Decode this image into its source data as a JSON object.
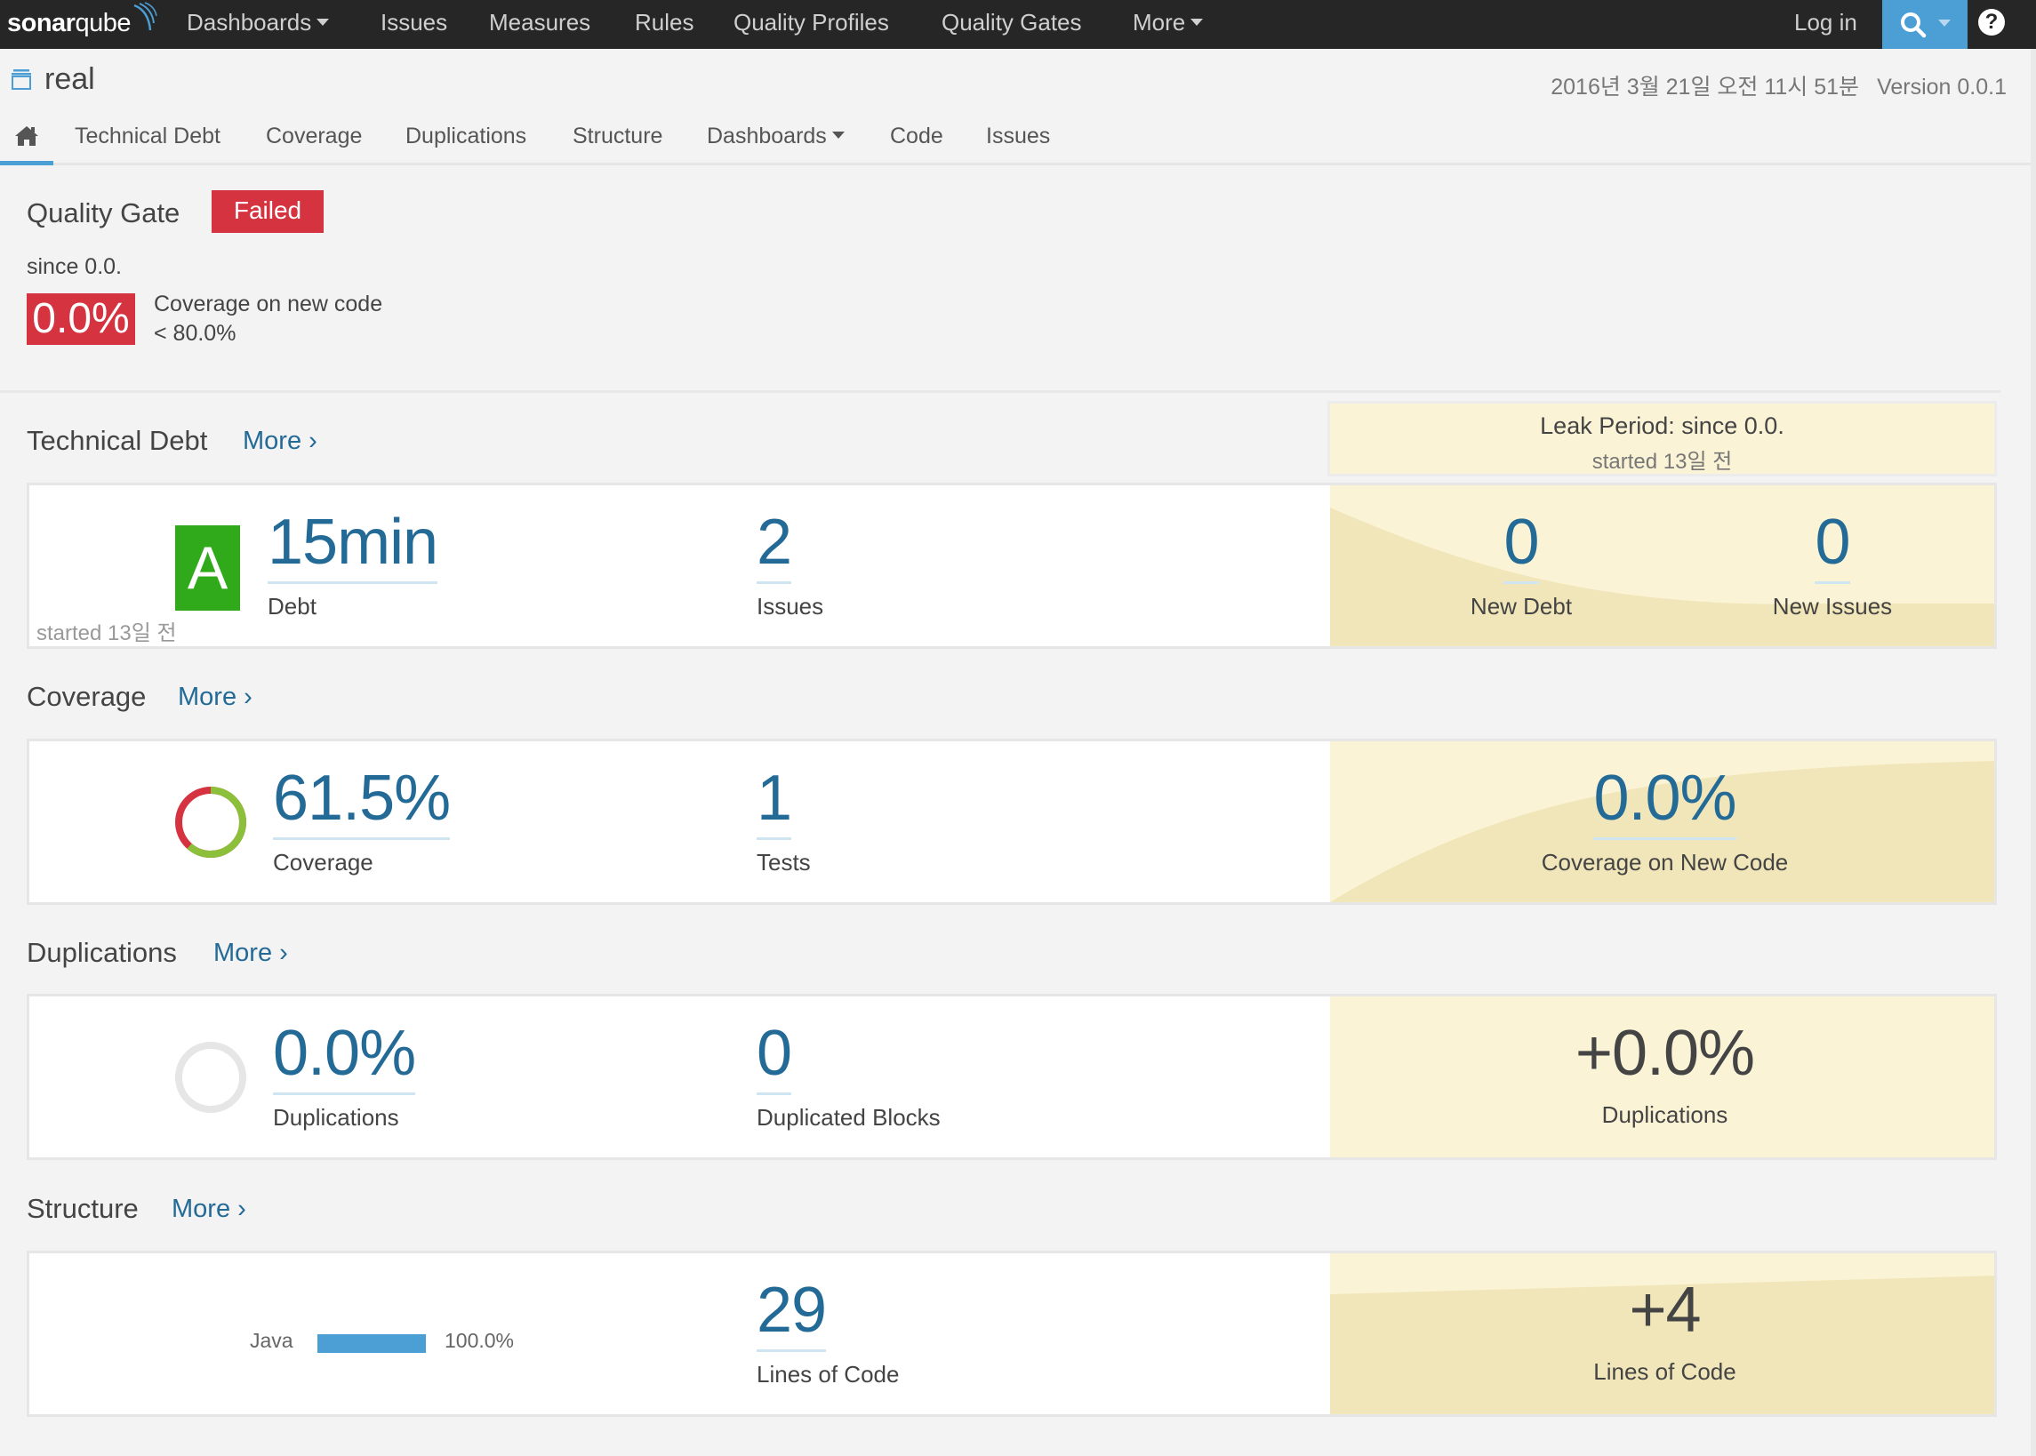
{
  "topnav": {
    "logo": {
      "bold": "sonar",
      "light": "qube"
    },
    "items": [
      {
        "label": "Dashboards",
        "dropdown": true
      },
      {
        "label": "Issues"
      },
      {
        "label": "Measures"
      },
      {
        "label": "Rules"
      },
      {
        "label": "Quality Profiles"
      },
      {
        "label": "Quality Gates"
      },
      {
        "label": "More",
        "dropdown": true
      }
    ],
    "login": "Log in",
    "search_icon": "search-icon",
    "help_icon": "?"
  },
  "project": {
    "name": "real",
    "icon": "project-icon",
    "date": "2016년 3월 21일 오전 11시 51분",
    "version": "Version 0.0.1"
  },
  "subnav": {
    "home_icon": "home-icon",
    "tabs": [
      {
        "label": "Technical Debt"
      },
      {
        "label": "Coverage"
      },
      {
        "label": "Duplications"
      },
      {
        "label": "Structure"
      },
      {
        "label": "Dashboards",
        "dropdown": true
      },
      {
        "label": "Code"
      },
      {
        "label": "Issues"
      }
    ]
  },
  "quality_gate": {
    "title": "Quality Gate",
    "status": "Failed",
    "since": "since 0.0.",
    "condition": {
      "value": "0.0%",
      "metric": "Coverage on new code",
      "threshold": "< 80.0%"
    }
  },
  "colors": {
    "accent": "#4b9fd5",
    "link": "#236a97",
    "error": "#d4333f",
    "rating_a": "#30a91b",
    "leak_bg": "#fbf3d5",
    "leak_chart": "#f0e6b9",
    "coverage_good": "#8cc03b"
  },
  "more_label": "More",
  "leak_period": {
    "title": "Leak Period: since 0.0.",
    "started": "started 13일 전"
  },
  "technical_debt": {
    "title": "Technical Debt",
    "rating": "A",
    "started": "started 13일 전",
    "debt": {
      "value": "15min",
      "label": "Debt"
    },
    "issues": {
      "value": "2",
      "label": "Issues"
    },
    "new_debt": {
      "value": "0",
      "label": "New Debt"
    },
    "new_issues": {
      "value": "0",
      "label": "New Issues"
    }
  },
  "coverage": {
    "title": "Coverage",
    "coverage_percent": 61.5,
    "coverage": {
      "value": "61.5%",
      "label": "Coverage"
    },
    "tests": {
      "value": "1",
      "label": "Tests"
    },
    "new_coverage": {
      "value": "0.0%",
      "label": "Coverage on New Code"
    }
  },
  "duplications": {
    "title": "Duplications",
    "duplications": {
      "value": "0.0%",
      "label": "Duplications"
    },
    "blocks": {
      "value": "0",
      "label": "Duplicated Blocks"
    },
    "new_duplications": {
      "value": "+0.0%",
      "label": "Duplications"
    }
  },
  "structure": {
    "title": "Structure",
    "languages": [
      {
        "name": "Java",
        "percent": "100.0%",
        "fraction": 1.0
      }
    ],
    "loc": {
      "value": "29",
      "label": "Lines of Code"
    },
    "new_loc": {
      "value": "+4",
      "label": "Lines of Code"
    }
  }
}
